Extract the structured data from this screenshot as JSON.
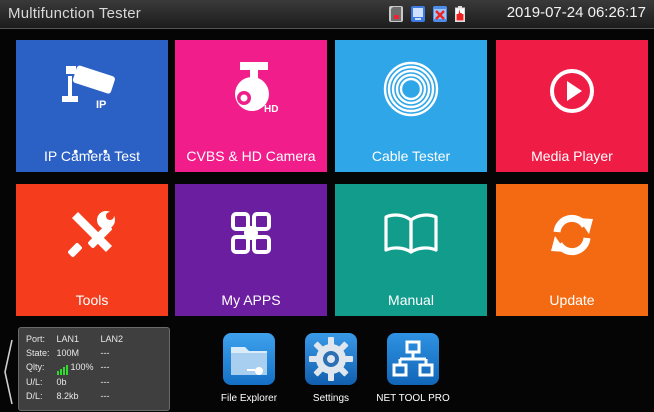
{
  "app_title": "Multifunction Tester",
  "datetime": "2019-07-24 06:26:17",
  "status_icons": [
    "sd-card-icon",
    "usb-icon",
    "no-network-icon",
    "battery-icon"
  ],
  "tiles": [
    {
      "label": "IP Camera Test",
      "color": "#2b60c4",
      "icon": "ip-camera-icon",
      "extra": "• • •"
    },
    {
      "label": "CVBS & HD Camera",
      "color": "#f01d8a",
      "icon": "ptz-camera-icon"
    },
    {
      "label": "Cable Tester",
      "color": "#2ea6e8",
      "icon": "cable-coil-icon"
    },
    {
      "label": "Media Player",
      "color": "#ef1d46",
      "icon": "play-icon"
    },
    {
      "label": "Tools",
      "color": "#f53d1d",
      "icon": "tools-icon"
    },
    {
      "label": "My APPS",
      "color": "#6b1fa0",
      "icon": "apps-icon"
    },
    {
      "label": "Manual",
      "color": "#119c8c",
      "icon": "book-icon"
    },
    {
      "label": "Update",
      "color": "#f46a12",
      "icon": "refresh-icon"
    }
  ],
  "net_panel": {
    "headers": [
      "Port:",
      "LAN1",
      "LAN2"
    ],
    "rows": [
      {
        "label": "State:",
        "lan1": "100M",
        "lan2": "---"
      },
      {
        "label": "Qlty:",
        "lan1": "100%",
        "lan2": "---"
      },
      {
        "label": "U/L:",
        "lan1": "0b",
        "lan2": "---"
      },
      {
        "label": "D/L:",
        "lan1": "8.2kb",
        "lan2": "---"
      }
    ],
    "signal_color": "#2fdc2f"
  },
  "dock": [
    {
      "label": "File Explorer",
      "icon": "folder-icon",
      "color": "#1e88d8"
    },
    {
      "label": "Settings",
      "icon": "gear-icon",
      "color": "#1c7fd0"
    },
    {
      "label": "NET TOOL PRO",
      "icon": "network-topology-icon",
      "color": "#1a7ccc"
    }
  ]
}
